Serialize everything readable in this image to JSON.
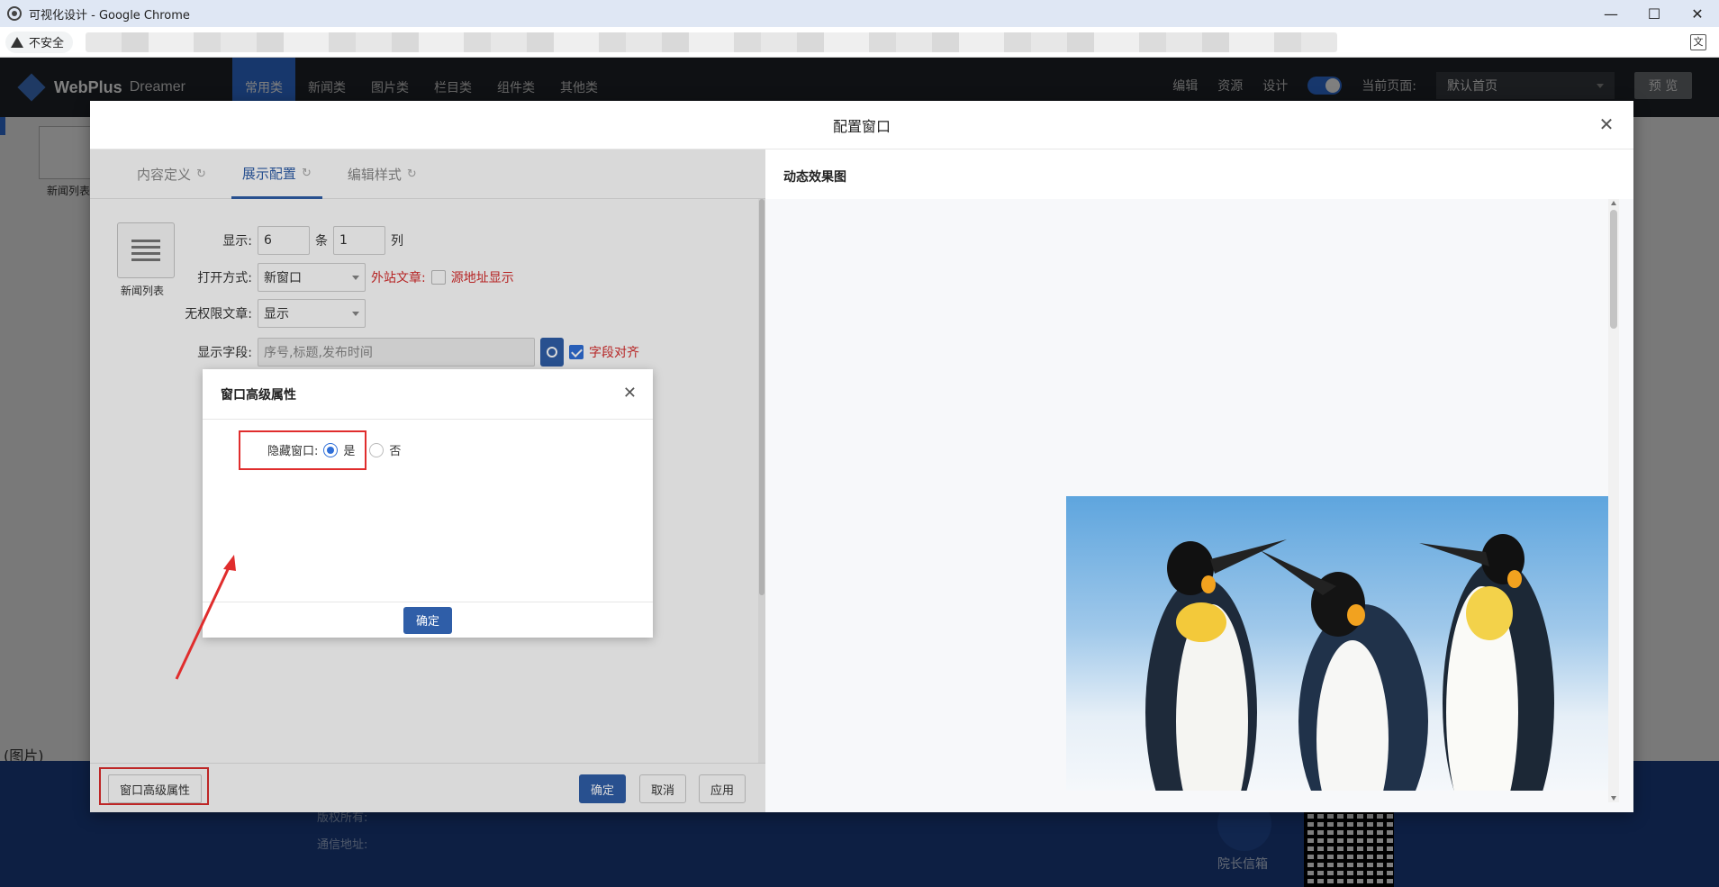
{
  "browser": {
    "title": "可视化设计 - Google Chrome",
    "security_label": "不安全",
    "window_controls": [
      "minimize-icon",
      "maximize-icon",
      "close-icon"
    ]
  },
  "app_nav": {
    "logo_main": "WebPlus",
    "logo_sub": "Dreamer",
    "tabs": [
      {
        "label": "常用类",
        "active": true
      },
      {
        "label": "新闻类"
      },
      {
        "label": "图片类"
      },
      {
        "label": "栏目类"
      },
      {
        "label": "组件类"
      },
      {
        "label": "其他类"
      }
    ],
    "right_links": [
      "编辑",
      "资源",
      "设计"
    ],
    "current_page_label": "当前页面:",
    "current_page_value": "默认首页",
    "preview_label": "预 览"
  },
  "background": {
    "widget_label": "新闻列表",
    "caption": "(图片)",
    "footer_copyright": "版权所有:",
    "footer_address": "通信地址:",
    "mailbox_label": "院长信箱"
  },
  "modal": {
    "title": "配置窗口",
    "tabs": [
      {
        "label": "内容定义",
        "active": false
      },
      {
        "label": "展示配置",
        "active": true
      },
      {
        "label": "编辑样式",
        "active": false
      }
    ],
    "widget_label": "新闻列表",
    "form": {
      "show_label": "显示:",
      "show_count": "6",
      "show_count_unit": "条",
      "show_cols": "1",
      "show_cols_unit": "列",
      "open_mode_label": "打开方式:",
      "open_mode_value": "新窗口",
      "external_label": "外站文章:",
      "source_url_label": "源地址显示",
      "no_permission_label": "无权限文章:",
      "no_permission_value": "显示",
      "fields_label": "显示字段:",
      "fields_placeholder": "序号,标题,发布时间",
      "align_label": "字段对齐",
      "align_checked": true
    },
    "footer": {
      "advanced_button": "窗口高级属性",
      "ok": "确定",
      "cancel": "取消",
      "apply": "应用"
    },
    "preview_title": "动态效果图"
  },
  "sub_dialog": {
    "title": "窗口高级属性",
    "hide_label": "隐藏窗口:",
    "option_yes": "是",
    "option_no": "否",
    "selected": "是",
    "ok": "确定"
  },
  "colors": {
    "accent": "#2f5ea8",
    "highlight": "#e02d2d"
  }
}
